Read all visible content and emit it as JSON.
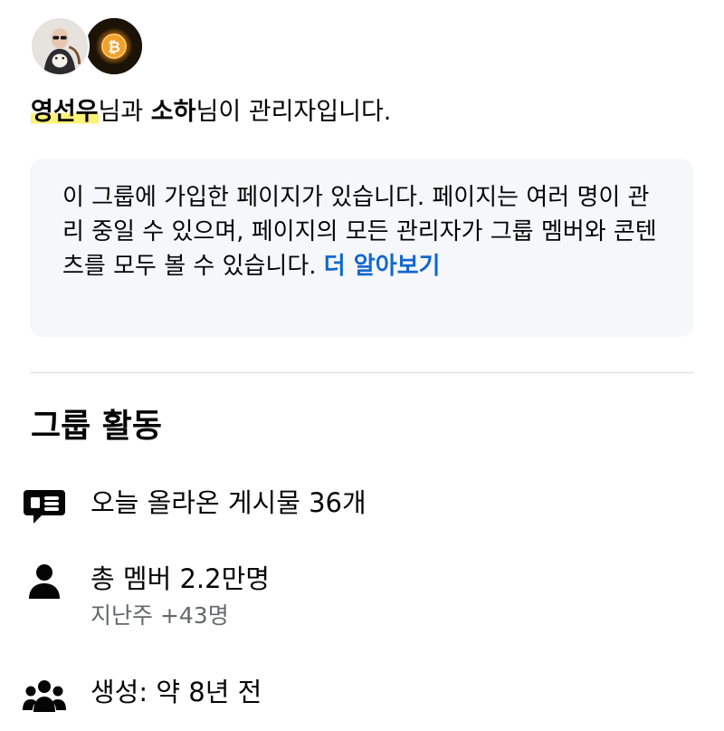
{
  "admins": {
    "name_1": "영선우",
    "connector_1": "님과 ",
    "name_2": "소하",
    "connector_2": "님이 관리자입니다."
  },
  "info_card": {
    "text": "이 그룹에 가입한 페이지가 있습니다. 페이지는 여러 명이 관리 중일 수 있으며, 페이지의 모든 관리자가 그룹 멤버와 콘텐츠를 모두 볼 수 있습니다. ",
    "learn_more": "더 알아보기"
  },
  "activity": {
    "title": "그룹 활동",
    "posts_today": "오늘 올라온 게시물 36개",
    "total_members": "총 멤버 2.2만명",
    "members_last_week": "지난주 +43명",
    "created": "생성: 약 8년 전"
  },
  "colors": {
    "link": "#1467cc",
    "highlight": "#fbf27a",
    "card_background": "#f5f7fa",
    "secondary_text": "#65676b"
  },
  "icons": {
    "posts": "speech-bubble-icon",
    "members": "person-icon",
    "created": "group-icon"
  }
}
